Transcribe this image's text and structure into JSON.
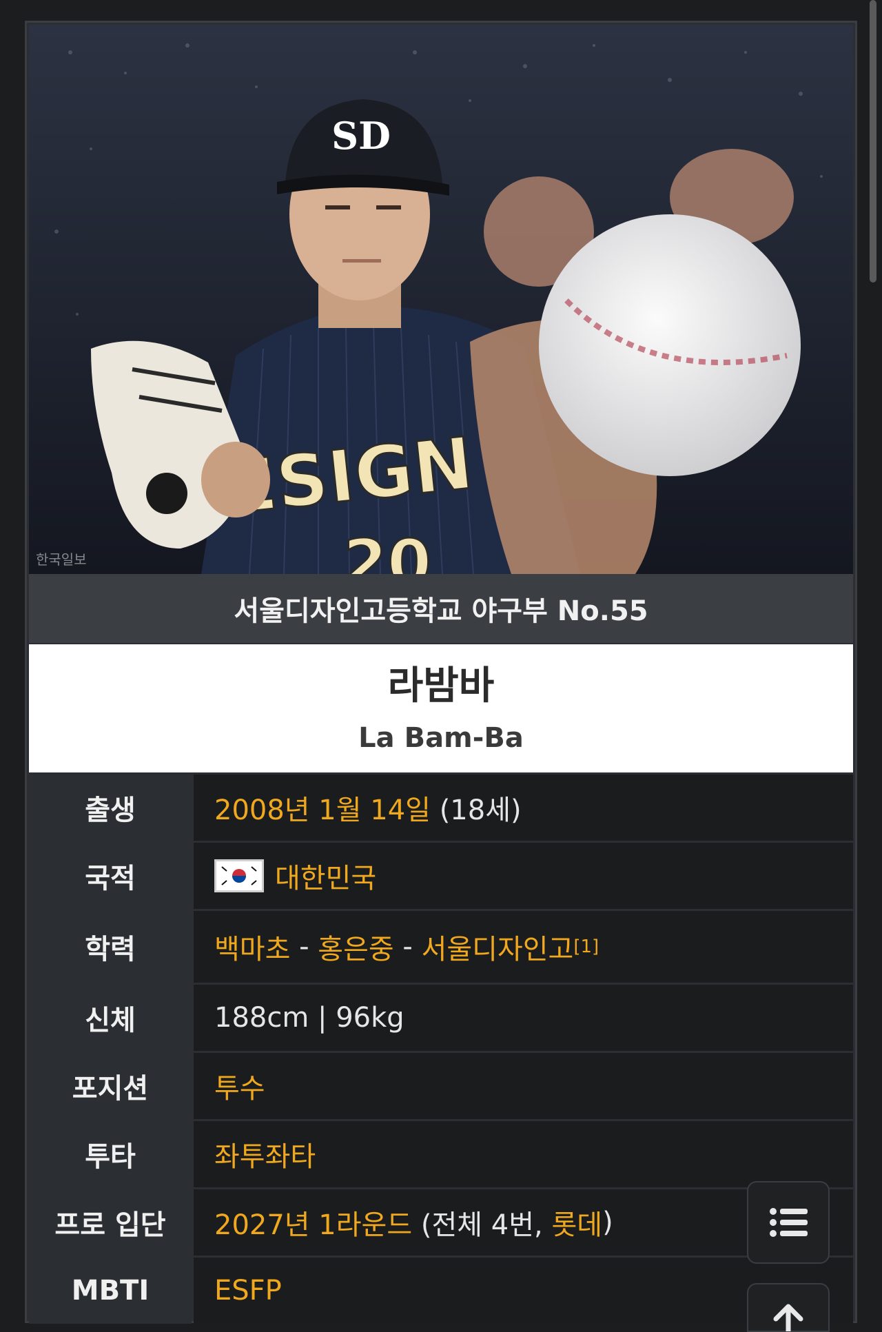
{
  "photo": {
    "jersey_text": "ESIGN",
    "jersey_number": "20",
    "cap_logo": "SD",
    "watermark": "한국일보"
  },
  "caption": "서울디자인고등학교 야구부 No.55",
  "name_ko": "라밤바",
  "name_en": "La Bam-Ba",
  "rows": {
    "birth": {
      "label": "출생",
      "value": "2008년 1월 14일",
      "extra": " (18세)"
    },
    "nationality": {
      "label": "국적",
      "value": "대한민국",
      "flag": "south-korea-flag"
    },
    "education": {
      "label": "학력",
      "school1": "백마초",
      "sep1": " - ",
      "school2": "홍은중",
      "sep2": " - ",
      "school3": "서울디자인고",
      "ref": "[1]"
    },
    "body": {
      "label": "신체",
      "value": "188cm | 96kg"
    },
    "position": {
      "label": "포지션",
      "value": "투수"
    },
    "bats_throws": {
      "label": "투타",
      "value": "좌투좌타"
    },
    "draft": {
      "label": "프로 입단",
      "value": "2027년 1라운드",
      "mid": " (전체 4번, ",
      "team": "롯데",
      "close": ")"
    },
    "mbti": {
      "label": "MBTI",
      "value": "ESFP"
    }
  },
  "buttons": {
    "toc_icon": "list-icon",
    "top_icon": "arrow-up-icon"
  },
  "colors": {
    "link": "#f0a81e",
    "header_bg": "#3b3e43",
    "label_bg": "#2b2e32",
    "value_bg": "#1b1c1e"
  }
}
